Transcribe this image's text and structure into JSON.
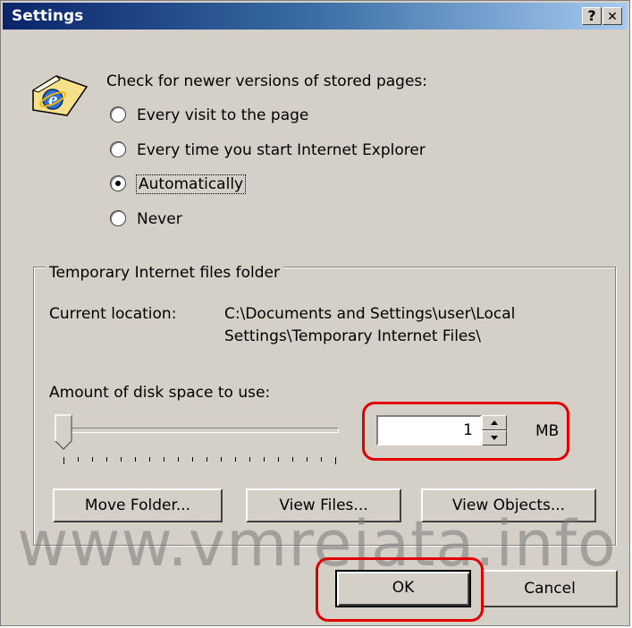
{
  "window": {
    "title": "Settings",
    "help_label": "?",
    "close_label": "✕"
  },
  "check_section": {
    "heading": "Check for newer versions of stored pages:",
    "options": [
      {
        "label": "Every visit to the page",
        "selected": false
      },
      {
        "label": "Every time you start Internet Explorer",
        "selected": false
      },
      {
        "label": "Automatically",
        "selected": true
      },
      {
        "label": "Never",
        "selected": false
      }
    ]
  },
  "temp_folder": {
    "group_label": "Temporary Internet files folder",
    "current_location_label": "Current location:",
    "current_location_line1": "C:\\Documents and Settings\\user\\Local",
    "current_location_line2": "Settings\\Temporary Internet Files\\",
    "disk_space_label": "Amount of disk space to use:",
    "disk_space_value": "1",
    "disk_space_unit": "MB",
    "slider_level": 0
  },
  "buttons": {
    "move_folder": "Move Folder...",
    "view_files": "View Files...",
    "view_objects": "View Objects...",
    "ok": "OK",
    "cancel": "Cancel"
  },
  "watermark": "www.vmrejata.info",
  "colors": {
    "dialog_bg": "#d4d0c8",
    "titlebar_start": "#0a246a",
    "highlight_red": "#e00000"
  }
}
